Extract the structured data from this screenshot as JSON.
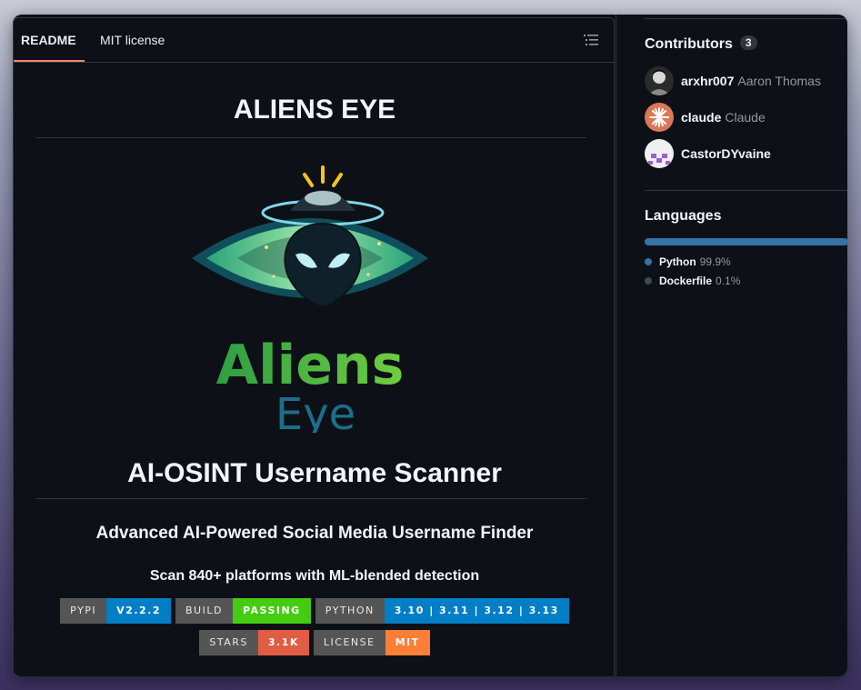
{
  "tabs": [
    {
      "label": "README",
      "active": true
    },
    {
      "label": "MIT license",
      "active": false
    }
  ],
  "readme": {
    "title": "ALIENS EYE",
    "logo": {
      "word1": "Aliens",
      "word2": "Eye"
    },
    "heading": "AI-OSINT Username Scanner",
    "subheading": "Advanced AI-Powered Social Media Username Finder",
    "tagline": "Scan 840+ platforms with ML-blended detection",
    "badges_row1": [
      {
        "label": "PYPI",
        "value": "V2.2.2",
        "color": "#007ec6"
      },
      {
        "label": "BUILD",
        "value": "PASSING",
        "color": "#4c1"
      },
      {
        "label": "PYTHON",
        "value": "3.10 | 3.11 | 3.12 | 3.13",
        "color": "#007ec6"
      }
    ],
    "badges_row2": [
      {
        "label": "STARS",
        "value": "3.1K",
        "color": "#e05d44"
      },
      {
        "label": "LICENSE",
        "value": "MIT",
        "color": "#fe7d37"
      }
    ]
  },
  "sidebar": {
    "contributors": {
      "title": "Contributors",
      "count": "3",
      "people": [
        {
          "login": "arxhr007",
          "name": "Aaron Thomas"
        },
        {
          "login": "claude",
          "name": "Claude"
        },
        {
          "login": "CastorDYvaine",
          "name": ""
        }
      ]
    },
    "languages": {
      "title": "Languages",
      "items": [
        {
          "name": "Python",
          "percent": "99.9%",
          "fraction": 0.999,
          "color": "#3572A5"
        },
        {
          "name": "Dockerfile",
          "percent": "0.1%",
          "fraction": 0.001,
          "color": "#384d54"
        }
      ]
    }
  },
  "colors": {
    "background": "#0d1117",
    "border": "#30363d",
    "tab_underline": "#f78166",
    "text": "#f0f6fc",
    "muted": "#9198a1"
  }
}
